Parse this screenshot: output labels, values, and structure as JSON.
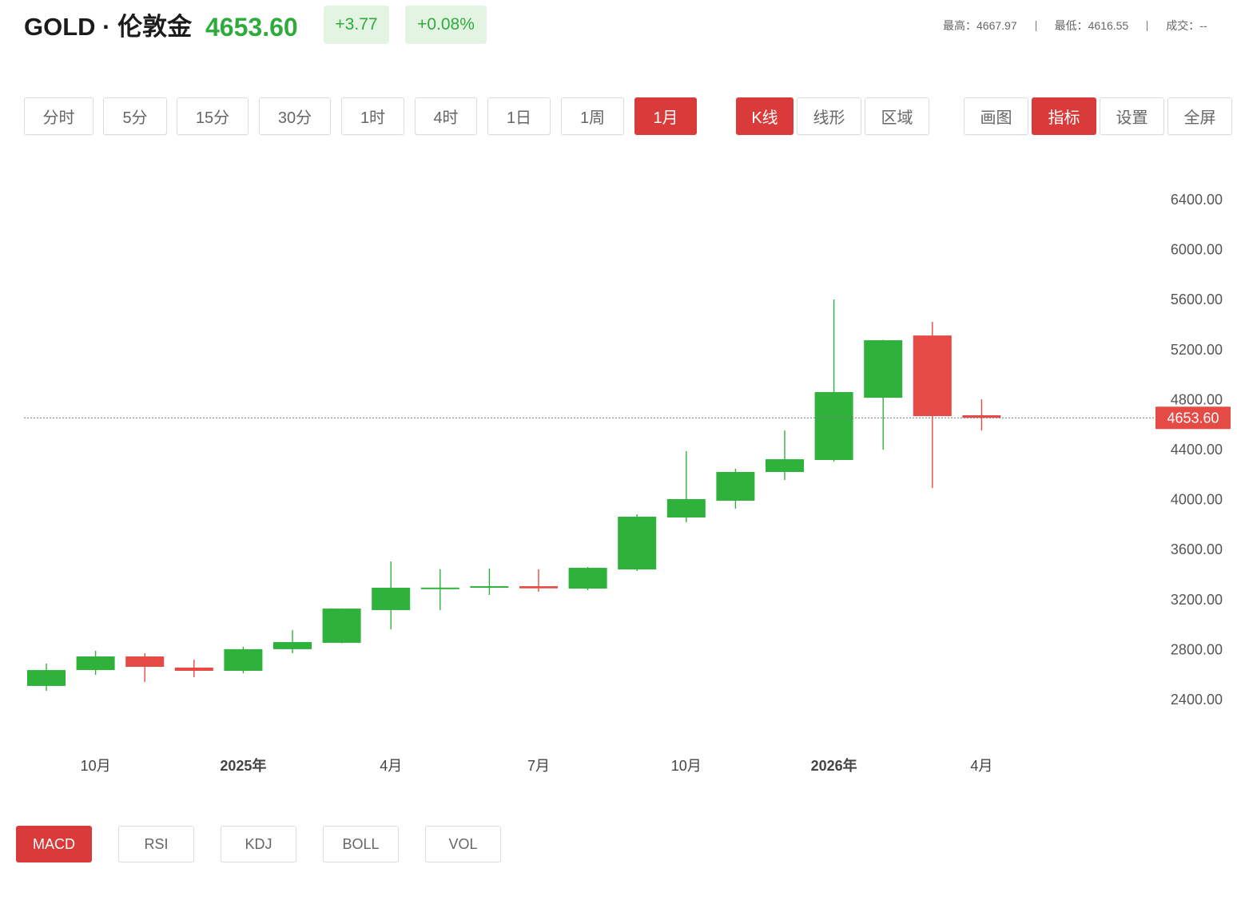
{
  "header": {
    "title": "GOLD · 伦敦金",
    "price": "4653.60",
    "change": "+3.77",
    "change_pct": "+0.08%",
    "stats": [
      {
        "label": "最高：",
        "value": "4667.97"
      },
      {
        "label": "最低：",
        "value": "4616.55"
      },
      {
        "label": "成交：",
        "value": "--"
      }
    ]
  },
  "toolbar": {
    "periods": [
      {
        "label": "分时",
        "active": false
      },
      {
        "label": "5分",
        "active": false
      },
      {
        "label": "15分",
        "active": false
      },
      {
        "label": "30分",
        "active": false
      },
      {
        "label": "1时",
        "active": false
      },
      {
        "label": "4时",
        "active": false
      },
      {
        "label": "1日",
        "active": false
      },
      {
        "label": "1周",
        "active": false
      },
      {
        "label": "1月",
        "active": true
      }
    ],
    "chart_types": [
      {
        "label": "K线",
        "active": true
      },
      {
        "label": "线形",
        "active": false
      },
      {
        "label": "区域",
        "active": false
      }
    ],
    "tools": [
      {
        "label": "画图",
        "active": false
      },
      {
        "label": "指标",
        "active": true
      },
      {
        "label": "设置",
        "active": false
      },
      {
        "label": "全屏",
        "active": false
      }
    ]
  },
  "indicators": [
    {
      "label": "MACD",
      "active": true
    },
    {
      "label": "RSI",
      "active": false
    },
    {
      "label": "KDJ",
      "active": false
    },
    {
      "label": "BOLL",
      "active": false
    },
    {
      "label": "VOL",
      "active": false
    }
  ],
  "colors": {
    "up": "#2fb23c",
    "down": "#e64a45",
    "accent": "#d93b3b",
    "price_text": "#2eab3c"
  },
  "chart_data": {
    "type": "candlestick",
    "ylim": [
      2400,
      6400
    ],
    "y_ticks": [
      "6400.00",
      "6000.00",
      "5600.00",
      "5200.00",
      "4800.00",
      "4400.00",
      "4000.00",
      "3600.00",
      "3200.00",
      "2800.00",
      "2400.00"
    ],
    "x_ticks": [
      {
        "label": "10月",
        "index": 1,
        "emphasis": false
      },
      {
        "label": "2025年",
        "index": 4,
        "emphasis": true
      },
      {
        "label": "4月",
        "index": 7,
        "emphasis": false
      },
      {
        "label": "7月",
        "index": 10,
        "emphasis": false
      },
      {
        "label": "10月",
        "index": 13,
        "emphasis": false
      },
      {
        "label": "2026年",
        "index": 16,
        "emphasis": true
      },
      {
        "label": "4月",
        "index": 19,
        "emphasis": false
      }
    ],
    "current_price": "4653.60",
    "grid": false,
    "candles": [
      {
        "o": 2509,
        "h": 2688,
        "l": 2470,
        "c": 2636
      },
      {
        "o": 2636,
        "h": 2790,
        "l": 2598,
        "c": 2745
      },
      {
        "o": 2745,
        "h": 2771,
        "l": 2541,
        "c": 2662
      },
      {
        "o": 2656,
        "h": 2719,
        "l": 2579,
        "c": 2630
      },
      {
        "o": 2630,
        "h": 2822,
        "l": 2611,
        "c": 2803
      },
      {
        "o": 2803,
        "h": 2956,
        "l": 2771,
        "c": 2860
      },
      {
        "o": 2854,
        "h": 3130,
        "l": 2850,
        "c": 3128
      },
      {
        "o": 3116,
        "h": 3505,
        "l": 2962,
        "c": 3295
      },
      {
        "o": 3294,
        "h": 3442,
        "l": 3116,
        "c": 3296
      },
      {
        "o": 3295,
        "h": 3448,
        "l": 3237,
        "c": 3307
      },
      {
        "o": 3307,
        "h": 3442,
        "l": 3263,
        "c": 3290
      },
      {
        "o": 3288,
        "h": 3461,
        "l": 3275,
        "c": 3454
      },
      {
        "o": 3441,
        "h": 3882,
        "l": 3429,
        "c": 3863
      },
      {
        "o": 3857,
        "h": 4387,
        "l": 3818,
        "c": 4004
      },
      {
        "o": 3991,
        "h": 4247,
        "l": 3927,
        "c": 4221
      },
      {
        "o": 4221,
        "h": 4553,
        "l": 4157,
        "c": 4323
      },
      {
        "o": 4317,
        "h": 5601,
        "l": 4304,
        "c": 4860
      },
      {
        "o": 4815,
        "h": 5278,
        "l": 4400,
        "c": 5275
      },
      {
        "o": 5313,
        "h": 5422,
        "l": 4093,
        "c": 4668
      },
      {
        "o": 4675,
        "h": 4803,
        "l": 4553,
        "c": 4654
      }
    ]
  }
}
